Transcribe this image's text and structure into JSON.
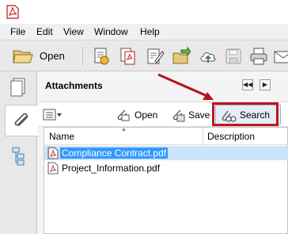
{
  "window": {
    "menu": [
      "File",
      "Edit",
      "View",
      "Window",
      "Help"
    ]
  },
  "toolbar": {
    "open_label": "Open",
    "icons": [
      "create-pdf-icon",
      "combine-files-icon",
      "edit-icon",
      "export-icon",
      "upload-icon",
      "save-icon",
      "print-icon",
      "email-icon"
    ]
  },
  "nav_pane": {
    "buttons": [
      "page-thumbnails-icon",
      "attachments-icon",
      "layers-icon"
    ]
  },
  "attachments_panel": {
    "title": "Attachments",
    "toolbar": {
      "options_icon": "options-menu-icon",
      "open_label": "Open",
      "save_label": "Save",
      "search_label": "Search"
    },
    "columns": {
      "name": "Name",
      "description": "Description"
    },
    "files": [
      {
        "name": "Compliance Contract.pdf",
        "selected": true
      },
      {
        "name": "Project_Information.pdf",
        "selected": false
      }
    ]
  },
  "colors": {
    "highlight": "#c0151f",
    "selection": "#3399ff",
    "pdf_red": "#d32f2f"
  }
}
